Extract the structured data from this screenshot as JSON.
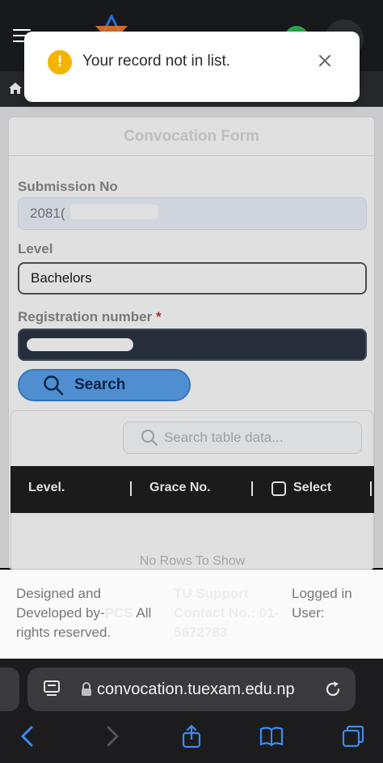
{
  "toast": {
    "message": "Your record not in list.",
    "icon": "warning-icon",
    "color": "#f4b400"
  },
  "form": {
    "title": "Convocation Form",
    "submission_label": "Submission No",
    "submission_value": "2081(",
    "level_label": "Level",
    "level_value": "Bachelors",
    "registration_label": "Registration number",
    "required_mark": "*",
    "search_label": "Search"
  },
  "table": {
    "search_placeholder": "Search table data...",
    "columns": [
      "Level.",
      "Grace No.",
      "Select"
    ],
    "empty_text": "No Rows To Show"
  },
  "footer": {
    "col1": [
      "Designed and",
      "Developed by-",
      "PCS",
      "All",
      "rights reserved."
    ],
    "col2": [
      "TU Support",
      "Contact No.: 01-",
      "5672783"
    ],
    "col3": [
      "Logged in",
      "User:"
    ]
  },
  "browser": {
    "url": "convocation.tuexam.edu.np"
  },
  "colors": {
    "accent": "#5aa3ee",
    "table_header": "#1f1f1f",
    "registration_field": "#2c3545"
  }
}
